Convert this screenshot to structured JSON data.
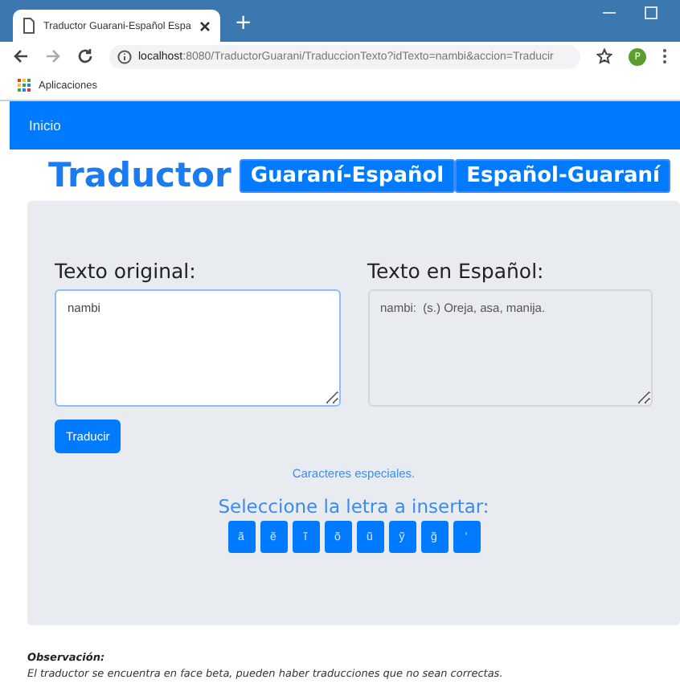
{
  "browser": {
    "tab_title": "Traductor Guarani-Español Espa",
    "new_tab": "+",
    "address_host": "localhost",
    "address_path": ":8080/TraductorGuarani/TraduccionTexto?idTexto=nambi&accion=Traducir",
    "profile_initial": "P",
    "bookmarks": [
      "Aplicaciones"
    ]
  },
  "navbar": {
    "items": [
      "Inicio"
    ]
  },
  "header": {
    "title": "Traductor",
    "modes": [
      {
        "label": "Guaraní-Español"
      },
      {
        "label": "Español-Guaraní"
      }
    ]
  },
  "form": {
    "source_label": "Texto original:",
    "source_value": "nambi",
    "target_label": "Texto en Español:",
    "target_value": "nambi:  (s.) Oreja, asa, manija.",
    "submit": "Traducir",
    "special_link": "Caracteres especiales.",
    "letters_label": "Seleccione la letra a insertar:",
    "letters": [
      "ã",
      "ẽ",
      "ĩ",
      "õ",
      "ũ",
      "ỹ",
      "g̃",
      "'"
    ]
  },
  "note": {
    "title": "Observación:",
    "text": "El traductor se encuentra en face beta, pueden haber traducciones que no sean correctas."
  }
}
